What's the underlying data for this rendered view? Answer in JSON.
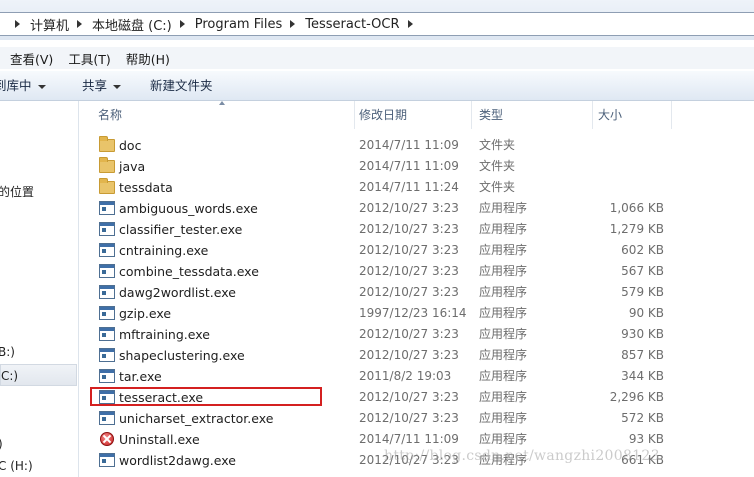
{
  "breadcrumb": [
    "计算机",
    "本地磁盘 (C:)",
    "Program Files",
    "Tesseract-OCR"
  ],
  "menu": [
    "查看(V)",
    "工具(T)",
    "帮助(H)"
  ],
  "commands": {
    "include_library": "到库中",
    "share": "共享",
    "new_folder": "新建文件夹"
  },
  "nav_items": [
    "的位置",
    "B:)",
    "C:)",
    ")",
    "C (H:)"
  ],
  "columns": {
    "name": "名称",
    "date": "修改日期",
    "type": "类型",
    "size": "大小"
  },
  "files": [
    {
      "name": "doc",
      "date": "2014/7/11 11:09",
      "type": "文件夹",
      "size": "",
      "icon": "folder-icon"
    },
    {
      "name": "java",
      "date": "2014/7/11 11:09",
      "type": "文件夹",
      "size": "",
      "icon": "folder-icon"
    },
    {
      "name": "tessdata",
      "date": "2014/7/11 11:24",
      "type": "文件夹",
      "size": "",
      "icon": "folder-icon"
    },
    {
      "name": "ambiguous_words.exe",
      "date": "2012/10/27 3:23",
      "type": "应用程序",
      "size": "1,066 KB",
      "icon": "exe-icon"
    },
    {
      "name": "classifier_tester.exe",
      "date": "2012/10/27 3:23",
      "type": "应用程序",
      "size": "1,279 KB",
      "icon": "exe-icon"
    },
    {
      "name": "cntraining.exe",
      "date": "2012/10/27 3:23",
      "type": "应用程序",
      "size": "602 KB",
      "icon": "exe-icon"
    },
    {
      "name": "combine_tessdata.exe",
      "date": "2012/10/27 3:23",
      "type": "应用程序",
      "size": "567 KB",
      "icon": "exe-icon"
    },
    {
      "name": "dawg2wordlist.exe",
      "date": "2012/10/27 3:23",
      "type": "应用程序",
      "size": "579 KB",
      "icon": "exe-icon"
    },
    {
      "name": "gzip.exe",
      "date": "1997/12/23 16:14",
      "type": "应用程序",
      "size": "90 KB",
      "icon": "exe-icon"
    },
    {
      "name": "mftraining.exe",
      "date": "2012/10/27 3:23",
      "type": "应用程序",
      "size": "930 KB",
      "icon": "exe-icon"
    },
    {
      "name": "shapeclustering.exe",
      "date": "2012/10/27 3:23",
      "type": "应用程序",
      "size": "857 KB",
      "icon": "exe-icon"
    },
    {
      "name": "tar.exe",
      "date": "2011/8/2 19:03",
      "type": "应用程序",
      "size": "344 KB",
      "icon": "exe-icon"
    },
    {
      "name": "tesseract.exe",
      "date": "2012/10/27 3:23",
      "type": "应用程序",
      "size": "2,296 KB",
      "icon": "exe-icon"
    },
    {
      "name": "unicharset_extractor.exe",
      "date": "2012/10/27 3:23",
      "type": "应用程序",
      "size": "572 KB",
      "icon": "exe-icon"
    },
    {
      "name": "Uninstall.exe",
      "date": "2014/7/11 11:09",
      "type": "应用程序",
      "size": "93 KB",
      "icon": "uninstall-icon"
    },
    {
      "name": "wordlist2dawg.exe",
      "date": "2012/10/27 3:23",
      "type": "应用程序",
      "size": "661 KB",
      "icon": "exe-icon"
    }
  ],
  "highlight_color": "#d42020",
  "watermark": "http://blog.csdn.net/wangzhi2008123"
}
